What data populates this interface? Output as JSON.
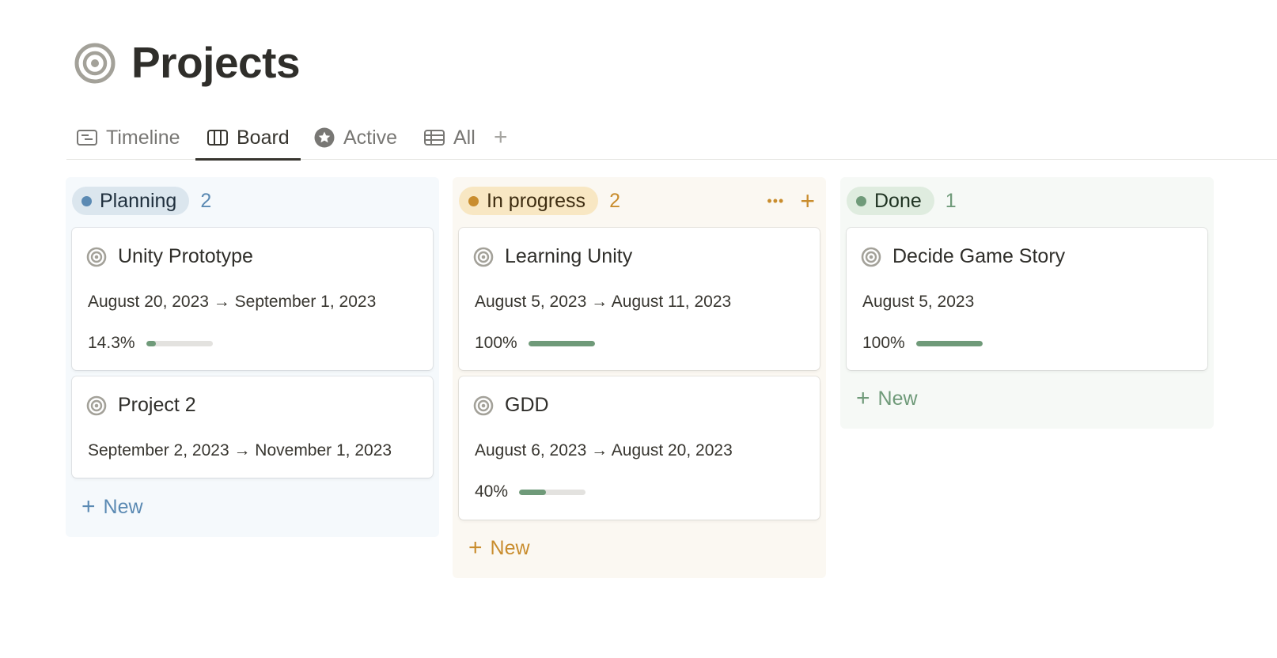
{
  "page": {
    "title": "Projects",
    "icon": "target-icon"
  },
  "tabs": [
    {
      "label": "Timeline",
      "icon": "timeline-icon",
      "active": false
    },
    {
      "label": "Board",
      "icon": "board-icon",
      "active": true
    },
    {
      "label": "Active",
      "icon": "star-icon",
      "active": false
    },
    {
      "label": "All",
      "icon": "table-icon",
      "active": false
    }
  ],
  "add_view_label": "+",
  "columns": [
    {
      "name": "Planning",
      "count": "2",
      "color": "#5b8ab3",
      "cards": [
        {
          "title": "Unity Prototype",
          "dates": "August 20, 2023 → September 1, 2023",
          "progress_label": "14.3%",
          "progress": 0.143
        },
        {
          "title": "Project 2",
          "dates": "September 2, 2023 → November 1, 2023"
        }
      ],
      "new_label": "New"
    },
    {
      "name": "In progress",
      "count": "2",
      "color": "#c98d2e",
      "actions": {
        "more": "•••",
        "add": "+"
      },
      "cards": [
        {
          "title": "Learning Unity",
          "dates": "August 5, 2023 → August 11, 2023",
          "progress_label": "100%",
          "progress": 1.0
        },
        {
          "title": "GDD",
          "dates": "August 6, 2023 → August 20, 2023",
          "progress_label": "40%",
          "progress": 0.4
        }
      ],
      "new_label": "New"
    },
    {
      "name": "Done",
      "count": "1",
      "color": "#6f9a79",
      "cards": [
        {
          "title": "Decide Game Story",
          "dates": "August 5, 2023",
          "progress_label": "100%",
          "progress": 1.0
        }
      ],
      "new_label": "New"
    }
  ]
}
